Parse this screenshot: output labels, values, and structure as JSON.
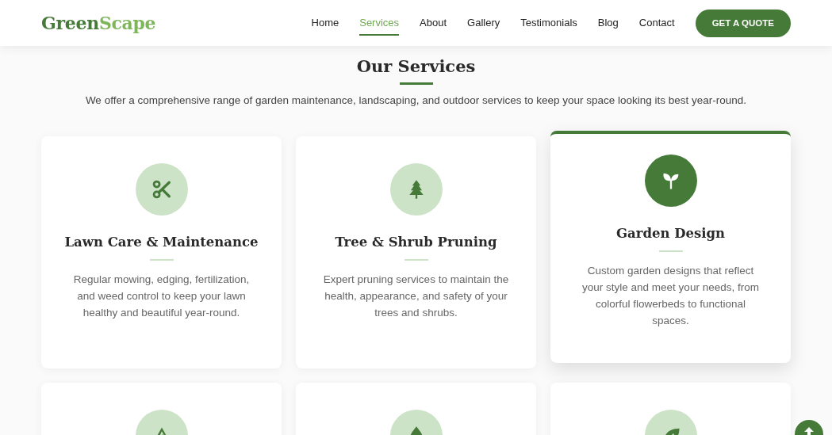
{
  "header": {
    "logo": {
      "first": "Green",
      "second": "Scape"
    },
    "nav": [
      {
        "label": "Home",
        "selected": false
      },
      {
        "label": "Services",
        "selected": true
      },
      {
        "label": "About",
        "selected": false
      },
      {
        "label": "Gallery",
        "selected": false
      },
      {
        "label": "Testimonials",
        "selected": false
      },
      {
        "label": "Blog",
        "selected": false
      },
      {
        "label": "Contact",
        "selected": false
      }
    ],
    "cta": "GET A QUOTE"
  },
  "section": {
    "title": "Our Services",
    "subtitle": "We offer a comprehensive range of garden maintenance, landscaping, and outdoor services to keep your space looking its best year-round.",
    "cards": [
      {
        "title": "Lawn Care & Maintenance",
        "description": "Regular mowing, edging, fertilization, and weed control to keep your lawn healthy and beautiful year-round.",
        "highlighted": false
      },
      {
        "title": "Tree & Shrub Pruning",
        "description": "Expert pruning services to maintain the health, appearance, and safety of your trees and shrubs.",
        "highlighted": false
      },
      {
        "title": "Garden Design",
        "description": "Custom garden designs that reflect your style and meet your needs, from colorful flowerbeds to functional spaces.",
        "highlighted": true
      },
      {
        "highlighted": false
      },
      {
        "highlighted": false
      },
      {
        "highlighted": false
      }
    ]
  }
}
